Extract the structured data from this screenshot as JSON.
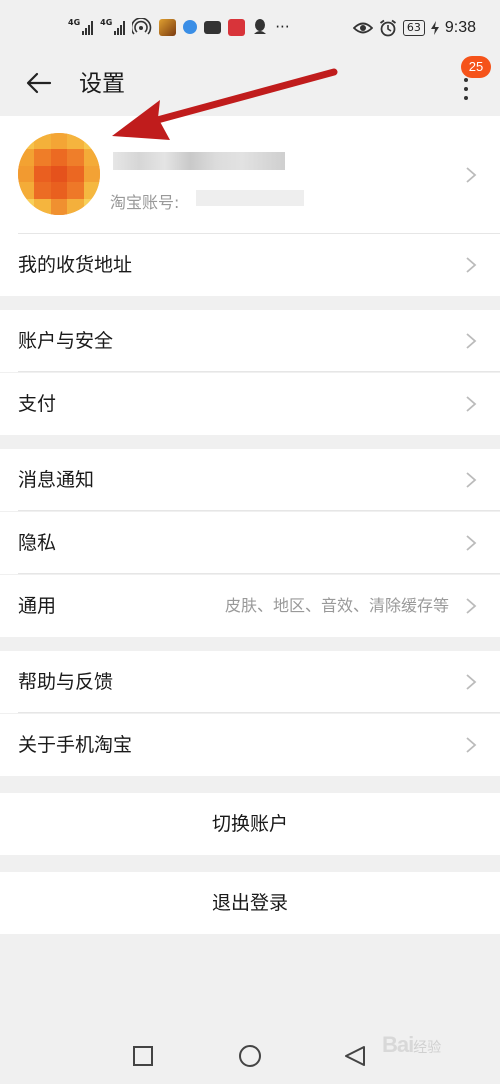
{
  "status_bar": {
    "signal_1": "4G",
    "signal_2": "4G",
    "notification_more": "···",
    "battery": "63",
    "time": "9:38",
    "icons": [
      "signal-icon",
      "signal-icon",
      "hotspot-icon",
      "game-app-icon",
      "browser-app-icon",
      "mail-app-icon",
      "book-app-icon",
      "qq-icon",
      "eye-icon",
      "alarm-icon",
      "battery-icon",
      "charging-icon"
    ]
  },
  "header": {
    "title": "设置",
    "badge_count": "25"
  },
  "profile": {
    "account_label": "淘宝账号:"
  },
  "groups": [
    {
      "items": [
        {
          "label": "我的收货地址"
        }
      ]
    },
    {
      "items": [
        {
          "label": "账户与安全"
        },
        {
          "label": "支付"
        }
      ]
    },
    {
      "items": [
        {
          "label": "消息通知"
        },
        {
          "label": "隐私"
        },
        {
          "label": "通用",
          "hint": "皮肤、地区、音效、清除缓存等"
        }
      ]
    },
    {
      "items": [
        {
          "label": "帮助与反馈"
        },
        {
          "label": "关于手机淘宝"
        }
      ]
    }
  ],
  "actions": {
    "switch_account": "切换账户",
    "logout": "退出登录"
  },
  "watermark": {
    "brand": "Bai",
    "suffix": "经验"
  },
  "colors": {
    "accent": "#f5531a",
    "annotation_arrow": "#c01c1c",
    "background": "#f0f0f0"
  }
}
